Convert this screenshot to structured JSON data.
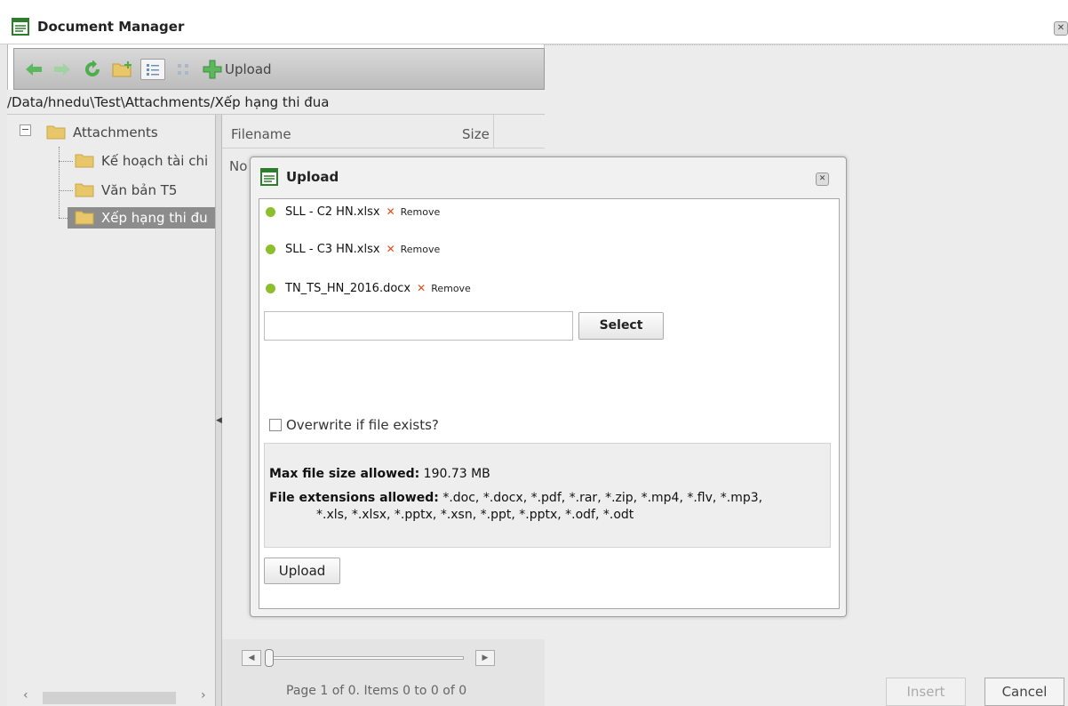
{
  "window": {
    "title": "Document Manager"
  },
  "toolbar": {
    "upload_label": "Upload"
  },
  "path": "/Data/hnedu\\Test\\Attachments/Xếp hạng thi đua",
  "tree": {
    "root": "Attachments",
    "children": [
      "Kế hoạch tài chi",
      "Văn bản T5",
      "Xếp hạng thi đu"
    ]
  },
  "files": {
    "col_filename": "Filename",
    "col_size": "Size",
    "no_items": "No"
  },
  "pager": {
    "text": "Page 1 of 0. Items 0 to 0 of 0"
  },
  "footer": {
    "insert": "Insert",
    "cancel": "Cancel"
  },
  "dialog": {
    "title": "Upload",
    "files": [
      {
        "name": "SLL - C2 HN.xlsx",
        "remove": "Remove"
      },
      {
        "name": "SLL - C3 HN.xlsx",
        "remove": "Remove"
      },
      {
        "name": "TN_TS_HN_2016.docx",
        "remove": "Remove"
      }
    ],
    "select_input_value": "",
    "select_label": "Select",
    "overwrite_label": "Overwrite if file exists?",
    "max_size_label": "Max file size allowed:",
    "max_size_value": "190.73 MB",
    "ext_label": "File extensions allowed:",
    "ext_value_1": "*.doc, *.docx, *.pdf, *.rar, *.zip, *.mp4, *.flv, *.mp3,",
    "ext_value_2": "*.xls, *.xlsx, *.pptx, *.xsn, *.ppt, *.pptx, *.odf, *.odt",
    "upload_label": "Upload"
  },
  "colors": {
    "status_dot": "#8dbe2b",
    "remove_x": "#e14b1b",
    "selected_row": "#8c8c8c"
  }
}
